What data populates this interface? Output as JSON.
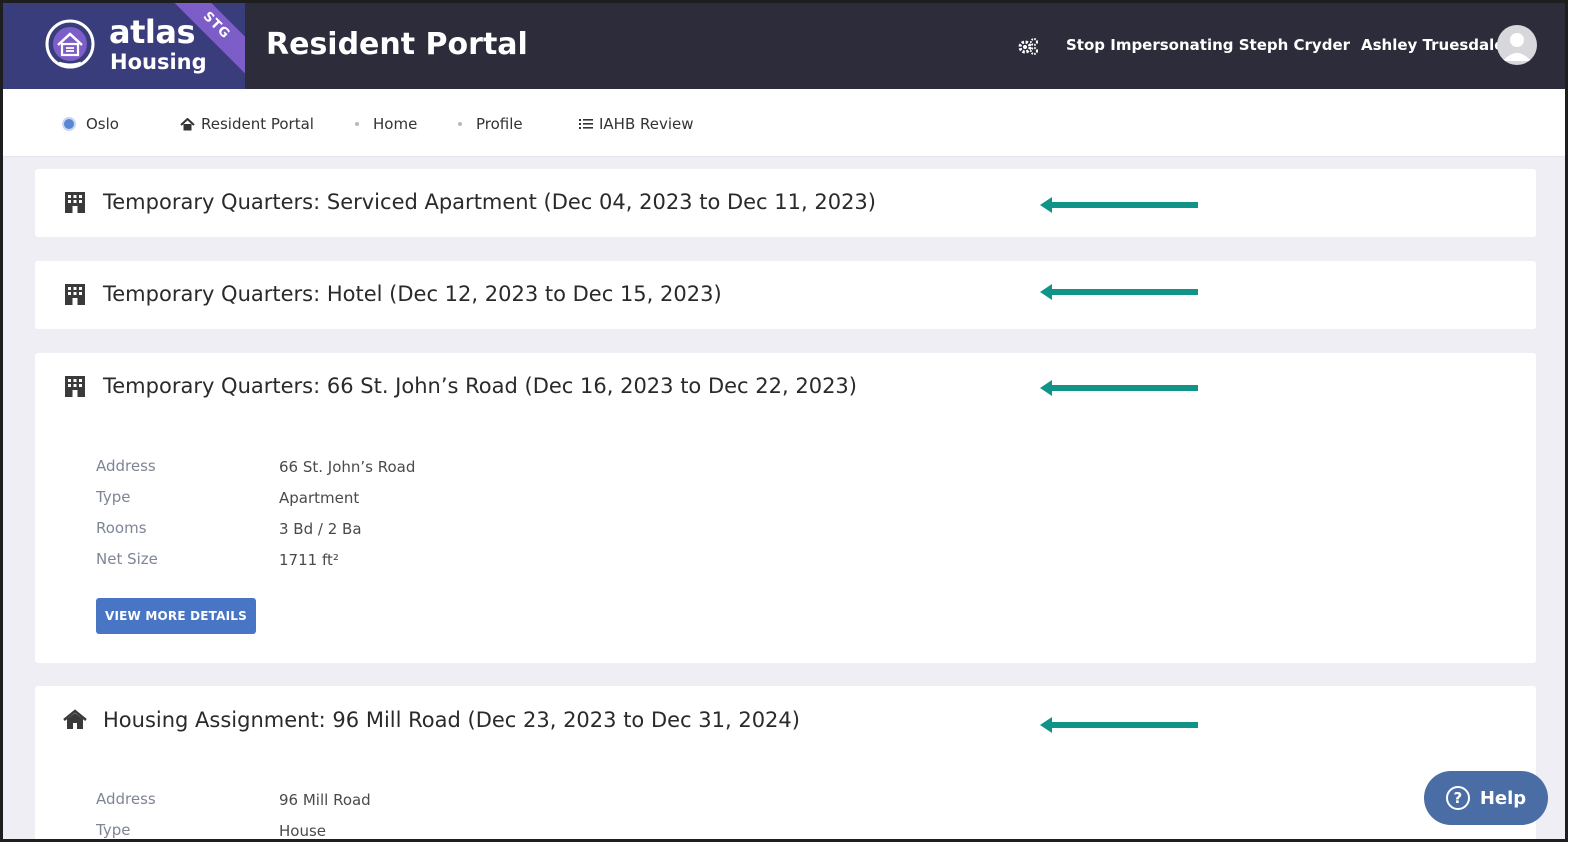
{
  "header": {
    "logo_atlas": "atlas",
    "logo_housing": "Housing",
    "env_badge": "STG",
    "title": "Resident Portal",
    "stop_impersonating": "Stop Impersonating Steph Cryder",
    "user_name": "Ashley Truesdale"
  },
  "nav": {
    "location": "Oslo",
    "items": [
      {
        "label": "Resident Portal",
        "icon": "home-icon"
      },
      {
        "label": "Home",
        "icon": "dot"
      },
      {
        "label": "Profile",
        "icon": "dot"
      },
      {
        "label": "IAHB Review",
        "icon": "list-icon"
      }
    ]
  },
  "cards": [
    {
      "title": "Temporary Quarters: Serviced Apartment (Dec 04, 2023 to Dec 11, 2023)",
      "icon": "building-icon"
    },
    {
      "title": "Temporary Quarters: Hotel (Dec 12, 2023 to Dec 15, 2023)",
      "icon": "building-icon"
    },
    {
      "title": "Temporary Quarters: 66 St. John’s Road (Dec 16, 2023 to Dec 22, 2023)",
      "icon": "building-icon",
      "details": [
        {
          "label": "Address",
          "value": "66 St. John’s Road"
        },
        {
          "label": "Type",
          "value": "Apartment"
        },
        {
          "label": "Rooms",
          "value": "3 Bd / 2 Ba"
        },
        {
          "label": "Net Size",
          "value": "1711 ft²"
        }
      ],
      "button": "VIEW MORE DETAILS"
    },
    {
      "title": "Housing Assignment: 96 Mill Road (Dec 23, 2023 to Dec 31, 2024)",
      "icon": "house-icon",
      "details": [
        {
          "label": "Address",
          "value": "96 Mill Road"
        },
        {
          "label": "Type",
          "value": "House"
        }
      ]
    }
  ],
  "help": {
    "label": "Help",
    "glyph": "?"
  },
  "colors": {
    "header_bg": "#2c2c3a",
    "logo_bg": "#3a3d7c",
    "badge": "#7d5ec8",
    "arrow": "#119488",
    "button": "#4876c4",
    "help": "#4a6da6"
  }
}
